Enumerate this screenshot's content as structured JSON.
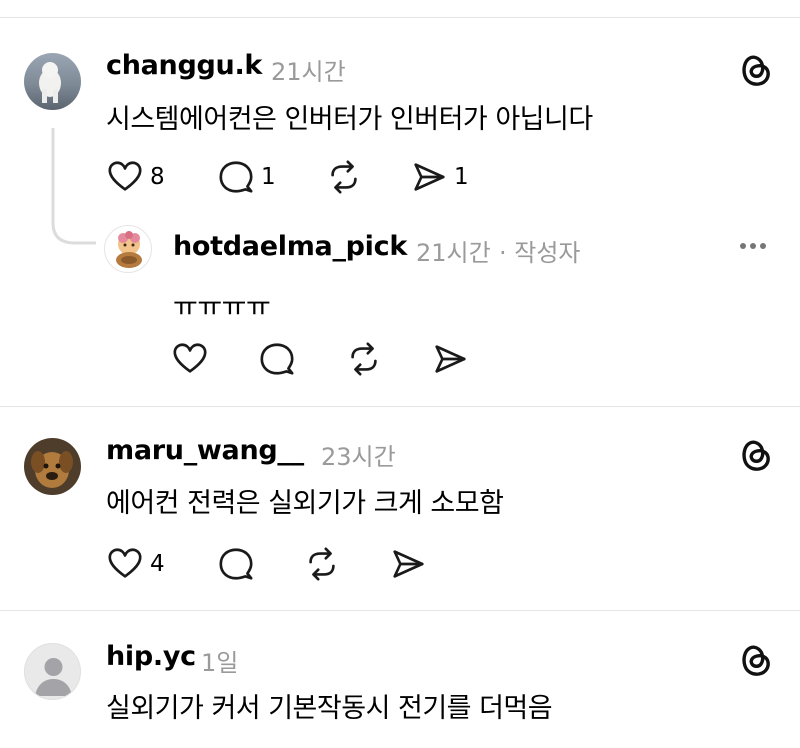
{
  "comments": [
    {
      "username": "changgu.k",
      "time": "21시간",
      "text": "시스템에어컨은 인버터가 인버터가 아닙니다",
      "likes": "8",
      "replies": "1",
      "shares": "1"
    },
    {
      "username": "hotdaelma_pick",
      "time": "21시간",
      "author_tag": "· 작성자",
      "text": "ㅠㅠㅠㅠ"
    },
    {
      "username": "maru_wang__",
      "time": "23시간",
      "text": "에어컨 전력은 실외기가 크게 소모함",
      "likes": "4"
    },
    {
      "username": "hip.yc",
      "time": "1일",
      "text": "실외기가 커서 기본작동시 전기를 더먹음"
    }
  ],
  "icons": {
    "like": "heart-icon",
    "reply": "comment-icon",
    "repost": "repost-icon",
    "share": "send-icon",
    "brand": "threads-logo-icon",
    "more": "more-options-icon"
  }
}
